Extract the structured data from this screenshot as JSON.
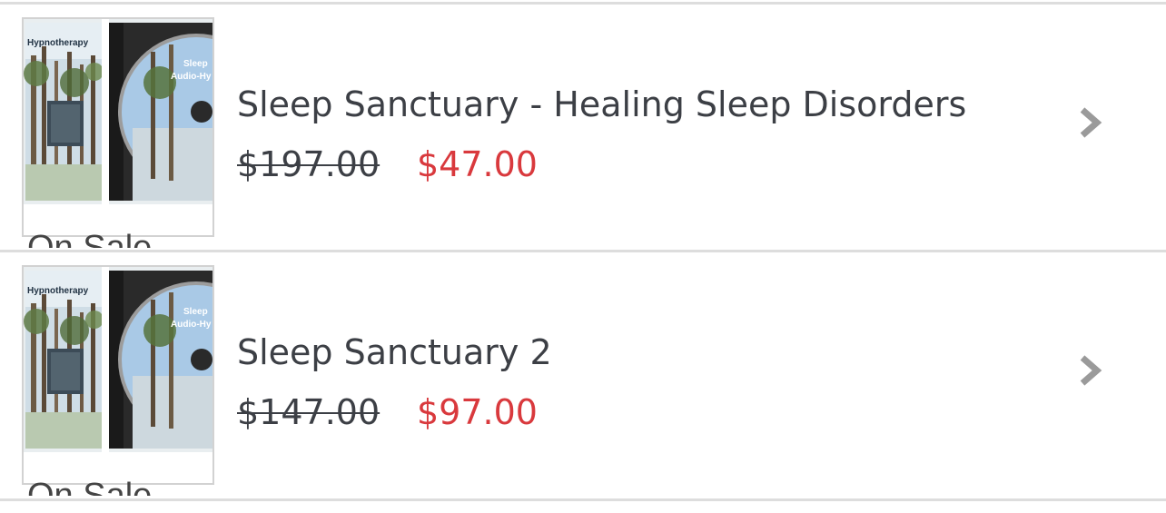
{
  "products": [
    {
      "title": "Sleep Sanctuary - Healing Sleep Disorders",
      "original_price": "$197.00",
      "sale_price": "$47.00",
      "badge": "On Sale",
      "cover_text_1": "Hypnotherapy",
      "cover_text_2": "Sleep",
      "cover_text_3": "Audio-Hy"
    },
    {
      "title": "Sleep Sanctuary 2",
      "original_price": "$147.00",
      "sale_price": "$97.00",
      "badge": "On Sale",
      "cover_text_1": "Hypnotherapy",
      "cover_text_2": "Sleep",
      "cover_text_3": "Audio-Hy"
    }
  ],
  "colors": {
    "divider": "#dddddd",
    "title": "#3c3f45",
    "sale_price": "#d9393d",
    "chevron": "#9a9a9a"
  },
  "icons": {
    "chevron": "chevron-right-icon"
  }
}
